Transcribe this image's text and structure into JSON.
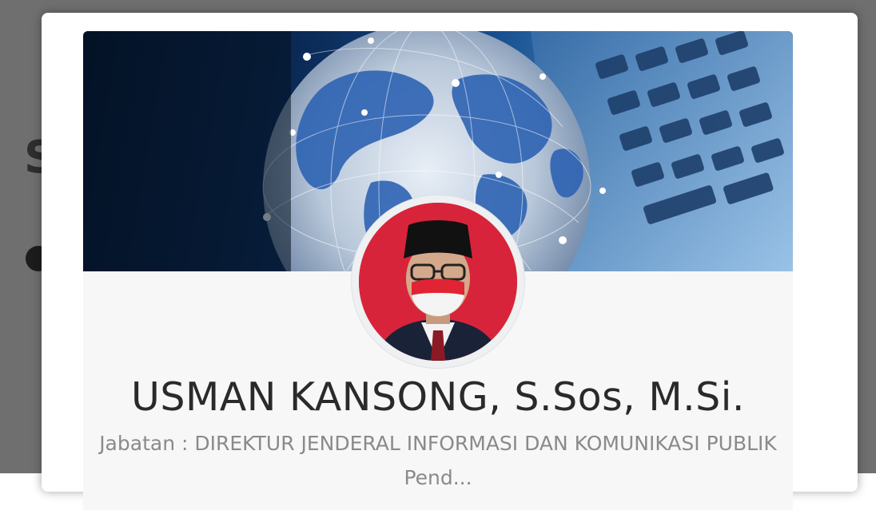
{
  "background": {
    "letter": "S"
  },
  "profile": {
    "name": "USMAN KANSONG, S.Sos, M.Si.",
    "position_label": "Jabatan",
    "position_value": "DIREKTUR JENDERAL INFORMASI DAN KOMUNIKASI PUBLIK",
    "next_line_partial": "Pend..."
  },
  "colors": {
    "backdrop": "#6f6f6f",
    "card": "#f7f7f7",
    "avatar_bg": "#d8243a",
    "name_text": "#2a2a2a",
    "secondary_text": "#8a8a8a"
  },
  "icons": {
    "banner": "globe-keyboard-banner-image",
    "avatar": "profile-photo"
  }
}
